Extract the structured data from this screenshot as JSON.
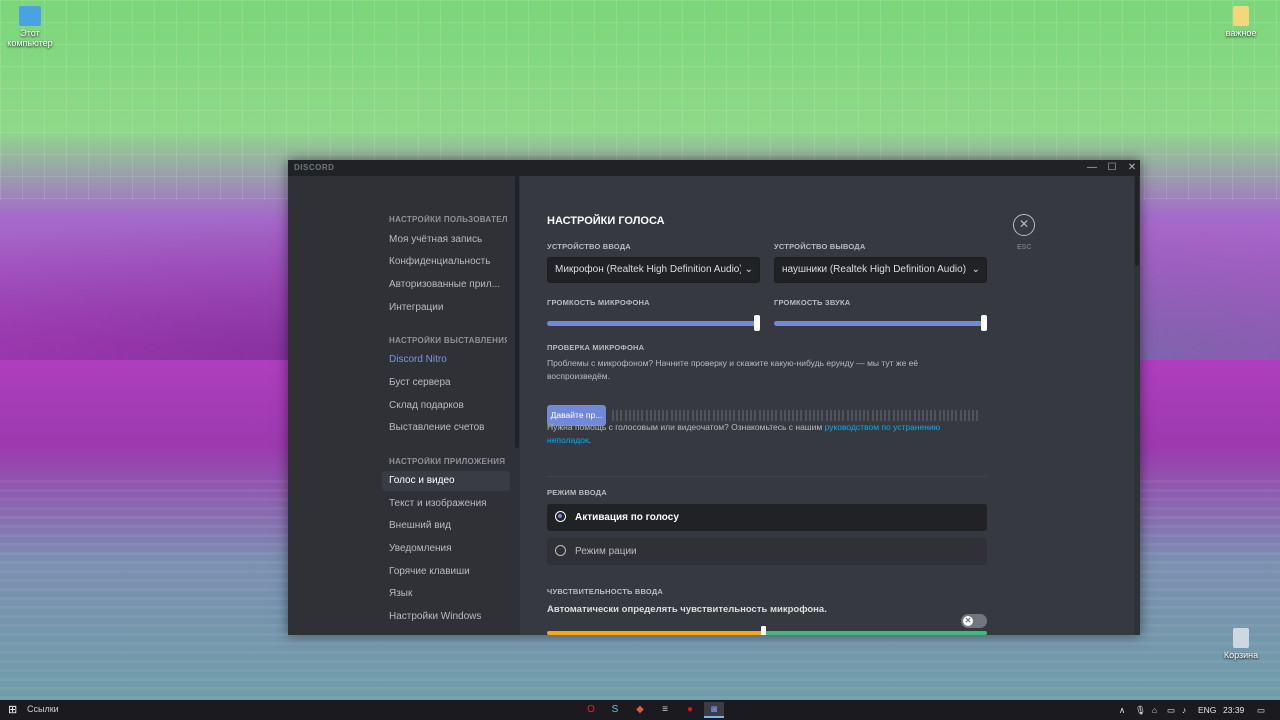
{
  "desktop": {
    "icons": [
      {
        "label": "Этот компьютер",
        "icon": "computer-icon"
      },
      {
        "label": "важное",
        "icon": "folder-icon"
      },
      {
        "label": "Корзина",
        "icon": "recycle-bin-icon"
      }
    ]
  },
  "window": {
    "brand": "DISCORD",
    "controls": {
      "minimize": "—",
      "maximize": "☐",
      "close": "✕"
    }
  },
  "sidebar": {
    "sections": [
      {
        "header": "НАСТРОЙКИ ПОЛЬЗОВАТЕЛЯ",
        "items": [
          "Моя учётная запись",
          "Конфиденциальность",
          "Авторизованные прил...",
          "Интеграции"
        ]
      },
      {
        "header": "НАСТРОЙКИ ВЫСТАВЛЕНИЯ...",
        "items": [
          "Discord Nitro",
          "Буст сервера",
          "Склад подарков",
          "Выставление счетов"
        ]
      },
      {
        "header": "НАСТРОЙКИ ПРИЛОЖЕНИЯ",
        "items": [
          "Голос и видео",
          "Текст и изображения",
          "Внешний вид",
          "Уведомления",
          "Горячие клавиши",
          "Язык",
          "Настройки Windows"
        ]
      }
    ],
    "active_item": "Голос и видео",
    "nitro_color": "#7d95e4"
  },
  "content": {
    "title": "НАСТРОЙКИ ГОЛОСА",
    "input_device": {
      "label": "УСТРОЙСТВО ВВОДА",
      "value": "Микрофон (Realtek High Definition Audio)"
    },
    "output_device": {
      "label": "УСТРОЙСТВО ВЫВОДА",
      "value": "наушники (Realtek High Definition Audio)"
    },
    "mic_volume": {
      "label": "ГРОМКОСТЬ МИКРОФОНА",
      "level": 1.0
    },
    "sound_volume": {
      "label": "ГРОМКОСТЬ ЗВУКА",
      "level": 1.0
    },
    "mic_test": {
      "label": "ПРОВЕРКА МИКРОФОНА",
      "description": "Проблемы с микрофоном? Начните проверку и скажите какую-нибудь ерунду — мы тут же её воспроизведём.",
      "button": "Давайте пр..."
    },
    "help": {
      "prefix": "Нужна помощь с голосовым или видеочатом? Ознакомьтесь с нашим ",
      "link": "руководством по устранению неполадок",
      "suffix": "."
    },
    "input_mode": {
      "label": "РЕЖИМ ВВОДА",
      "options": [
        "Активация по голосу",
        "Режим рации"
      ],
      "selected": "Активация по голосу"
    },
    "sensitivity": {
      "label": "ЧУВСТВИТЕЛЬНОСТЬ ВВОДА",
      "auto_text": "Автоматически определять чувствительность микрофона.",
      "auto_enabled": false,
      "threshold": 0.49
    },
    "close_label": "ESC",
    "accent": "#7289da",
    "link_color": "#00b0f4"
  },
  "taskbar": {
    "start": "⊞",
    "search_label": "Ссылки",
    "apps": [
      {
        "name": "opera",
        "glyph": "O",
        "color": "#ff1b2d"
      },
      {
        "name": "steam",
        "glyph": "S",
        "color": "#66c0f4"
      },
      {
        "name": "game",
        "glyph": "◆",
        "color": "#e25b3d"
      },
      {
        "name": "editor",
        "glyph": "≡",
        "color": "#cccccc"
      },
      {
        "name": "record",
        "glyph": "●",
        "color": "#e81123"
      },
      {
        "name": "discord",
        "glyph": "◙",
        "color": "#7289da"
      }
    ],
    "tray": {
      "chevron": "∧",
      "lang": "ENG",
      "time": "23:39",
      "notify": "▭"
    }
  }
}
